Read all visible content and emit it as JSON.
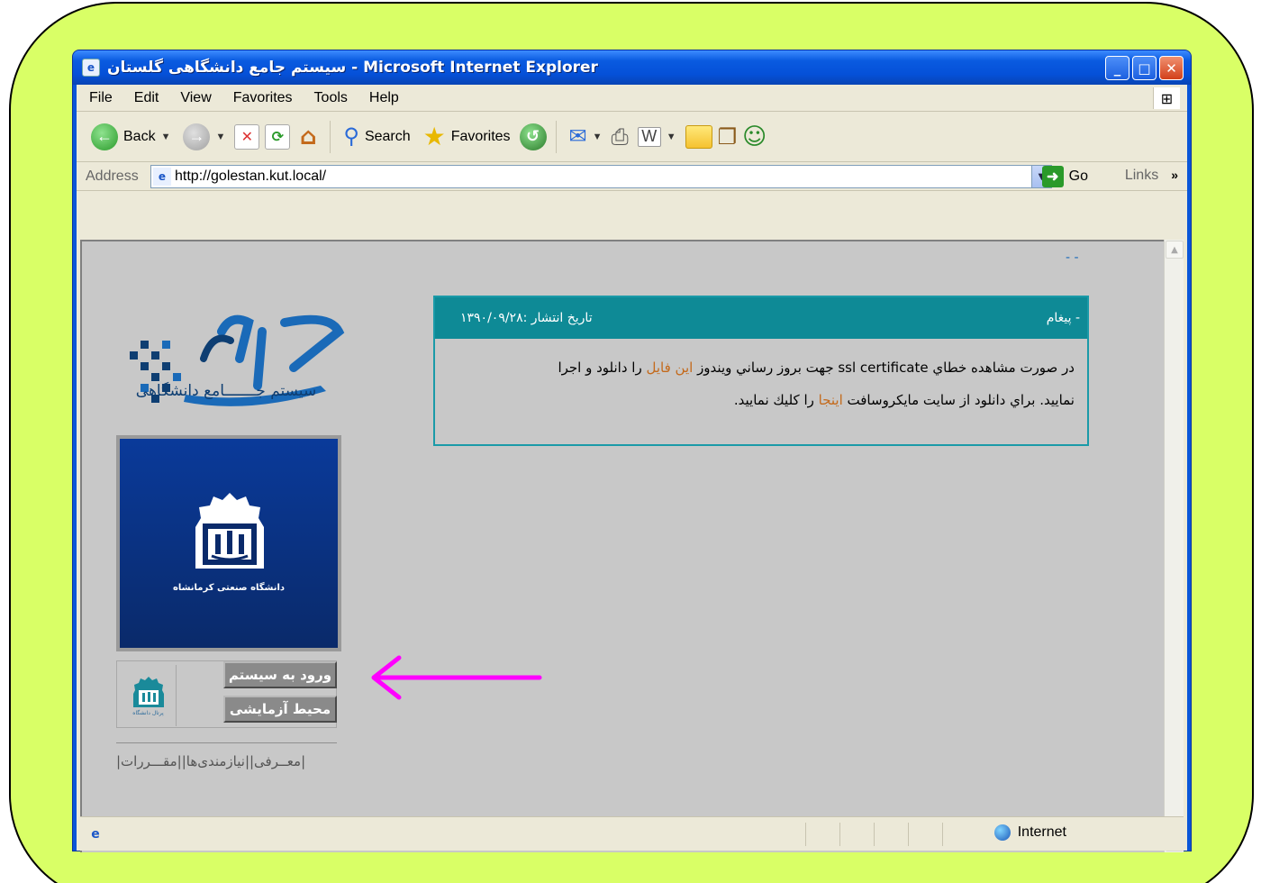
{
  "window": {
    "title": "سیستم جامع دانشگاهی گلستان - Microsoft Internet Explorer"
  },
  "menu": [
    "File",
    "Edit",
    "View",
    "Favorites",
    "Tools",
    "Help"
  ],
  "toolbar": {
    "back_label": "Back",
    "search_label": "Search",
    "favorites_label": "Favorites"
  },
  "address": {
    "label": "Address",
    "url": "http://golestan.kut.local/",
    "go_label": "Go",
    "links_label": "Links"
  },
  "status": {
    "zone_label": "Internet"
  },
  "page": {
    "logo_caption": "سیستم جـــــــامع دانشگاهی",
    "university_name": "دانشگاه صنعتی کرمانشاه",
    "mini_logo_text": "پرتال دانشگاه",
    "login_button": "ورود به سیستم",
    "test_button": "محیط آزمایشی",
    "footer_links": "|معــرفی||نیازمندی‌ها||مقـــررات|",
    "top_dots": "- -",
    "message": {
      "title": "- پیغام",
      "date": "تاریخ انتشار :۱۳۹۰/۰۹/۲۸",
      "line1_prefix": "در صورت مشاهده خطاي ssl certificate جهت بروز رساني ويندوز ",
      "link1": "اين فايل",
      "line1_suffix": " را دانلود و اجرا",
      "line2_prefix": "نماييد. براي دانلود از سايت مايكروسافت ",
      "link2": "اينجا",
      "line2_suffix": " را كليك نماييد."
    }
  },
  "colors": {
    "frame_bg": "#d9ff66",
    "xp_blue": "#0a56d8",
    "page_bg": "#c8c8c8",
    "message_header": "#0e8a96",
    "link_orange": "#c46a1c",
    "arrow_magenta": "#ff00ff"
  },
  "icons": [
    "ie-icon",
    "back-icon",
    "forward-icon",
    "stop-icon",
    "refresh-icon",
    "home-icon",
    "search-icon",
    "favorites-star-icon",
    "history-icon",
    "mail-icon",
    "print-icon",
    "edit-icon",
    "folder-icon",
    "research-icon",
    "messenger-icon",
    "go-arrow-icon",
    "globe-icon"
  ]
}
